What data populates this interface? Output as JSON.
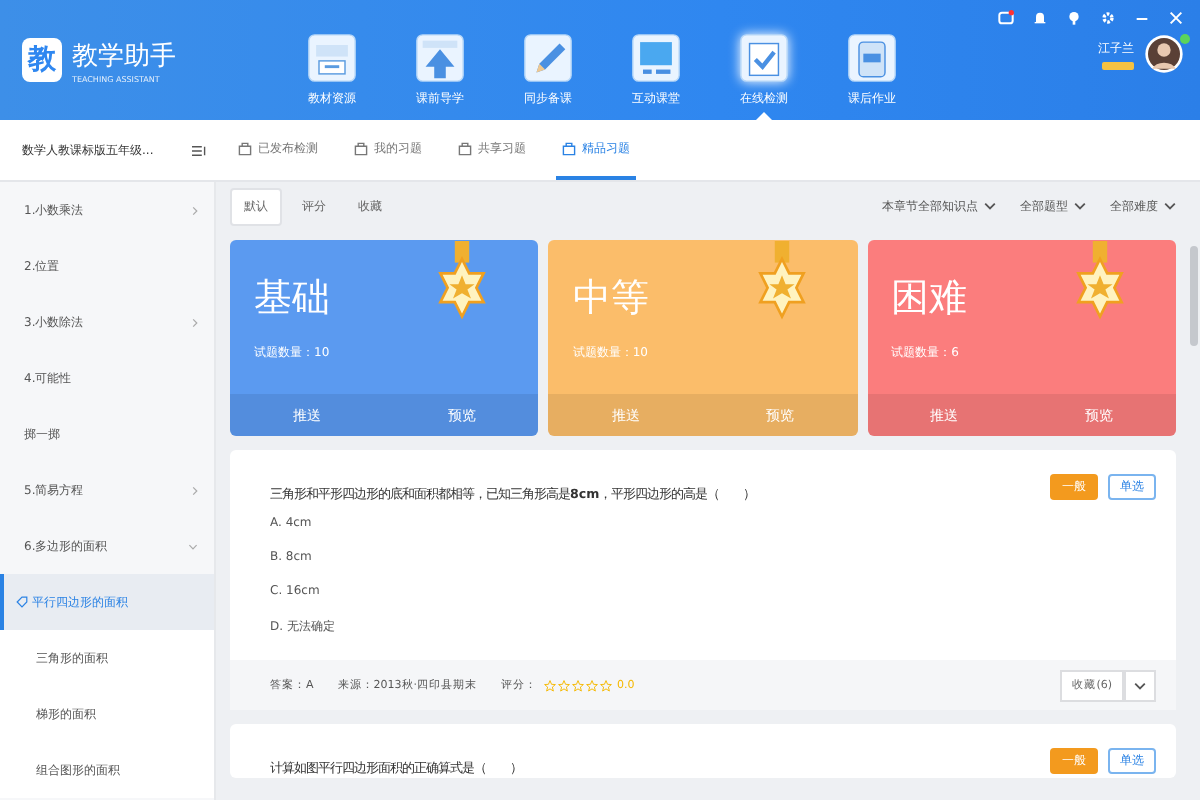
{
  "app": {
    "logo_glyph": "教",
    "name": "教学助手",
    "subtitle": "TEACHING ASSISTANT"
  },
  "nav": [
    {
      "label": "教材资源",
      "kind": "book",
      "selected": false
    },
    {
      "label": "课前导学",
      "kind": "arrow",
      "selected": false
    },
    {
      "label": "同步备课",
      "kind": "pencil",
      "selected": false
    },
    {
      "label": "互动课堂",
      "kind": "screen",
      "selected": false
    },
    {
      "label": "在线检测",
      "kind": "check",
      "selected": true
    },
    {
      "label": "课后作业",
      "kind": "bag",
      "selected": false
    }
  ],
  "user": {
    "name": "江子兰",
    "online": true
  },
  "book": {
    "title": "数学人教课标版五年级..."
  },
  "tabs": [
    {
      "label": "已发布检测",
      "selected": false
    },
    {
      "label": "我的习题",
      "selected": false
    },
    {
      "label": "共享习题",
      "selected": false
    },
    {
      "label": "精品习题",
      "selected": true
    }
  ],
  "sidebar": {
    "items": [
      {
        "label": "1.小数乘法",
        "expanded": false,
        "selected": false,
        "child": false
      },
      {
        "label": "2.位置",
        "selected": false,
        "child": false
      },
      {
        "label": "3.小数除法",
        "expanded": false,
        "selected": false,
        "child": false
      },
      {
        "label": "4.可能性",
        "selected": false,
        "child": false
      },
      {
        "label": "掷一掷",
        "selected": false,
        "child": false
      },
      {
        "label": "5.简易方程",
        "expanded": false,
        "selected": false,
        "child": false
      },
      {
        "label": "6.多边形的面积",
        "expanded": true,
        "selected": false,
        "child": false
      },
      {
        "label": "平行四边形的面积",
        "selected": true,
        "child": true
      },
      {
        "label": "三角形的面积",
        "selected": false,
        "child": true
      },
      {
        "label": "梯形的面积",
        "selected": false,
        "child": true
      },
      {
        "label": "组合图形的面积",
        "selected": false,
        "child": true
      }
    ]
  },
  "sort": [
    {
      "label": "默认",
      "selected": true
    },
    {
      "label": "评分",
      "selected": false
    },
    {
      "label": "收藏",
      "selected": false
    }
  ],
  "filters": [
    "本章节全部知识点",
    "全部题型",
    "全部难度"
  ],
  "levels": [
    {
      "title": "基础",
      "count": "试题数量：10",
      "color": "#5b9af0",
      "push": "推送",
      "preview": "预览"
    },
    {
      "title": "中等",
      "count": "试题数量：10",
      "color": "#fbbd6a",
      "push": "推送",
      "preview": "预览"
    },
    {
      "title": "困难",
      "count": "试题数量：6",
      "color": "#fb7d7d",
      "push": "推送",
      "preview": "预览"
    }
  ],
  "questions": [
    {
      "text": "三角形和平形四边形的底和面积都相等，已知三角形高是**8cm**，平形四边形的高是（　　）",
      "difficulty": "一般",
      "type": "单选",
      "options": [
        "A. 4cm",
        "B. 8cm",
        "C. 16cm",
        "D. 无法确定"
      ],
      "answer": "答案：A",
      "source": "来源：2013秋·四印县期末",
      "rating_label": "评分：",
      "stars": 0,
      "rating": "0.0",
      "collect": "收藏(6)"
    },
    {
      "text": "计算如图平行四边形面积的正确算式是（　　）",
      "difficulty": "一般",
      "type": "单选"
    }
  ]
}
